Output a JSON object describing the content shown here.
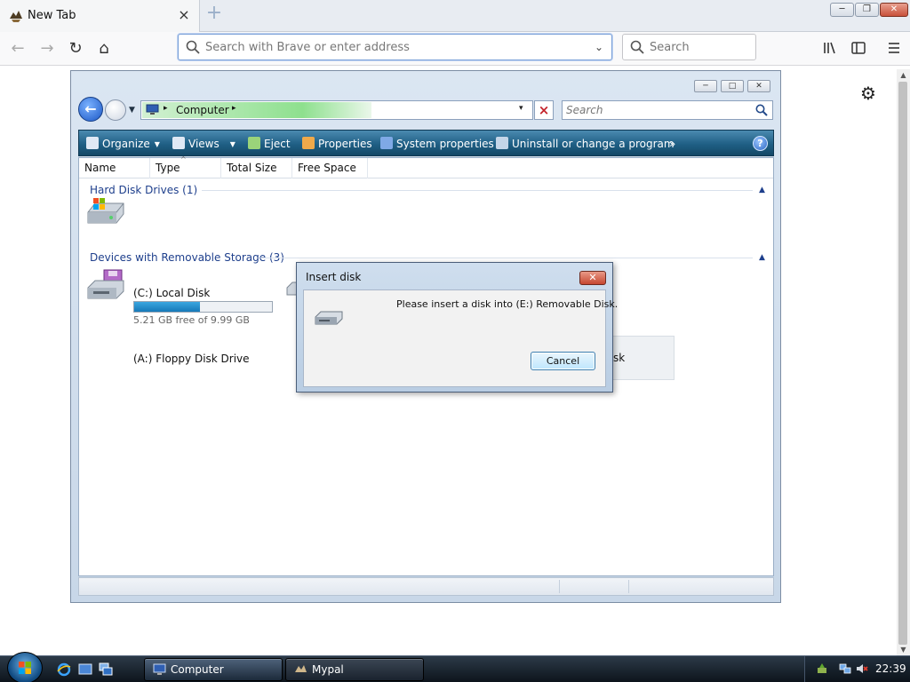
{
  "browser": {
    "tab": {
      "title": "New Tab",
      "close": "×"
    },
    "new_tab": "+",
    "window_controls": {
      "minimize": "─",
      "maximize": "❐",
      "close": "✕"
    },
    "nav": {
      "back": "←",
      "forward": "→",
      "reload": "↻",
      "home": "⌂"
    },
    "urlbar": {
      "value": "",
      "placeholder": "Search with Brave or enter address",
      "dropdown": "⌄"
    },
    "searchbar": {
      "value": "",
      "placeholder": "Search"
    },
    "toolbar_icons": [
      "library-icon",
      "sidebar-icon",
      "menu-icon"
    ],
    "settings_glyph": "⚙",
    "scroll_up": "▲",
    "scroll_down": "▼"
  },
  "explorer": {
    "caption": {
      "minimize": "─",
      "maximize": "□",
      "close": "✕"
    },
    "back": "←",
    "breadcrumb": {
      "separator": "▸",
      "location": "Computer",
      "dropdown": "▾"
    },
    "search_placeholder": "Search",
    "commands": [
      {
        "label": "Organize",
        "dropdown": "▼",
        "color": "#dfe8f4"
      },
      {
        "label": "Views",
        "dropdown": "▼",
        "color": "#dfe8f4"
      },
      {
        "label": "Eject",
        "color": "#9ad37a"
      },
      {
        "label": "Properties",
        "color": "#f0a94a"
      },
      {
        "label": "System properties",
        "color": "#7fa9e6"
      },
      {
        "label": "Uninstall or change a program",
        "color": "#c4d5e8"
      },
      {
        "label": "»"
      }
    ],
    "help": "?",
    "columns": [
      "Name",
      "Type",
      "Total Size",
      "Free Space"
    ],
    "sort_arrow": "^",
    "groups": [
      {
        "title": "Hard Disk Drives (1)",
        "collapse": "▲",
        "items": [
          {
            "name": "(C:) Local Disk",
            "free_text": "5.21 GB free of 9.99 GB",
            "used_fraction": 0.48
          }
        ]
      },
      {
        "title": "Devices with Removable Storage (3)",
        "collapse": "▲",
        "items": [
          {
            "name": "(A:) Floppy Disk Drive"
          },
          {
            "name": "sk"
          }
        ]
      }
    ]
  },
  "dialog": {
    "title": "Insert disk",
    "close": "✕",
    "message": "Please insert a disk into (E:) Removable Disk.",
    "cancel_label": "Cancel"
  },
  "taskbar": {
    "buttons": [
      {
        "label": "Computer",
        "active": true
      },
      {
        "label": "Mypal",
        "active": false
      }
    ],
    "clock": "22:39"
  },
  "colors": {
    "command_bar": "#1f5f85",
    "group_heading": "#1e3f8c",
    "capacity_fill": "#1679b8",
    "breadcrumb_progress": "#8ee08e"
  }
}
